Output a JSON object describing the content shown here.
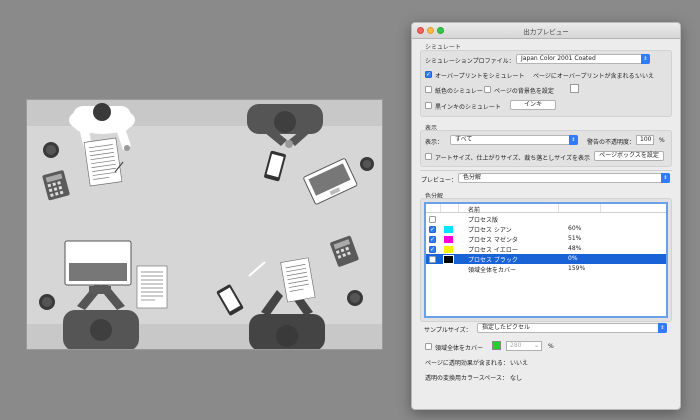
{
  "panel": {
    "title": "出力プレビュー",
    "simulate": {
      "section_label": "シミュレート",
      "profile_label": "シミュレーションプロファイル：",
      "profile_value": "Japan Color 2001 Coated",
      "overprint_label": "オーバープリントをシミュレート",
      "overprint_checked": true,
      "page_overprint_label": "ページにオーバープリントが含まれる：",
      "page_overprint_value": "いいえ",
      "paper_color_label": "紙色のシミュレート",
      "bg_color_label": "ページの背景色を設定",
      "black_ink_label": "黒インキのシミュレート",
      "ink_button": "インキ"
    },
    "display": {
      "section_label": "表示",
      "show_label": "表示：",
      "show_value": "すべて",
      "warning_label": "警告の不透明度：",
      "warning_value": "100",
      "warning_unit": "%",
      "art_size_label": "アートサイズ、仕上がりサイズ、裁ち落としサイズを表示",
      "page_box_button": "ページボックスを設定"
    },
    "preview": {
      "label": "プレビュー：",
      "value": "色分解"
    },
    "separations": {
      "section_label": "色分解",
      "name_header": "名前",
      "rows": [
        {
          "name": "プロセス版",
          "value": "",
          "checked": false,
          "color": "",
          "selected": false
        },
        {
          "name": "プロセス シアン",
          "value": "60%",
          "checked": true,
          "color": "#00e5ff",
          "selected": false
        },
        {
          "name": "プロセス マゼンタ",
          "value": "51%",
          "checked": true,
          "color": "#ff00d8",
          "selected": false
        },
        {
          "name": "プロセス イエロー",
          "value": "48%",
          "checked": true,
          "color": "#fff200",
          "selected": false
        },
        {
          "name": "プロセス ブラック",
          "value": "0%",
          "checked": false,
          "color": "#000000",
          "selected": true
        },
        {
          "name": "領域全体をカバー",
          "value": "159%",
          "checked": false,
          "color": "",
          "selected": false
        }
      ]
    },
    "sample_size_label": "サンプルサイズ：",
    "sample_size_value": "指定したピクセル",
    "total_area_label": "領域全体をカバー",
    "total_area_value": "280",
    "total_area_unit": "%",
    "transparency_label": "ページに透明効果が含まれる：",
    "transparency_value": "いいえ",
    "blend_space_label": "透明の変換用カラースペース：",
    "blend_space_value": "なし"
  },
  "colors": {
    "accent": "#2f7cf6",
    "selection": "#1a63d6",
    "total_area_swatch": "#23d12d"
  },
  "document_icons": [
    "person-top-left",
    "person-top-right",
    "person-bottom-left",
    "person-bottom-right",
    "laptop-icon",
    "smartphone-icon",
    "calculator-icon",
    "coffee-cup-icon",
    "document-icon",
    "pen-icon"
  ]
}
